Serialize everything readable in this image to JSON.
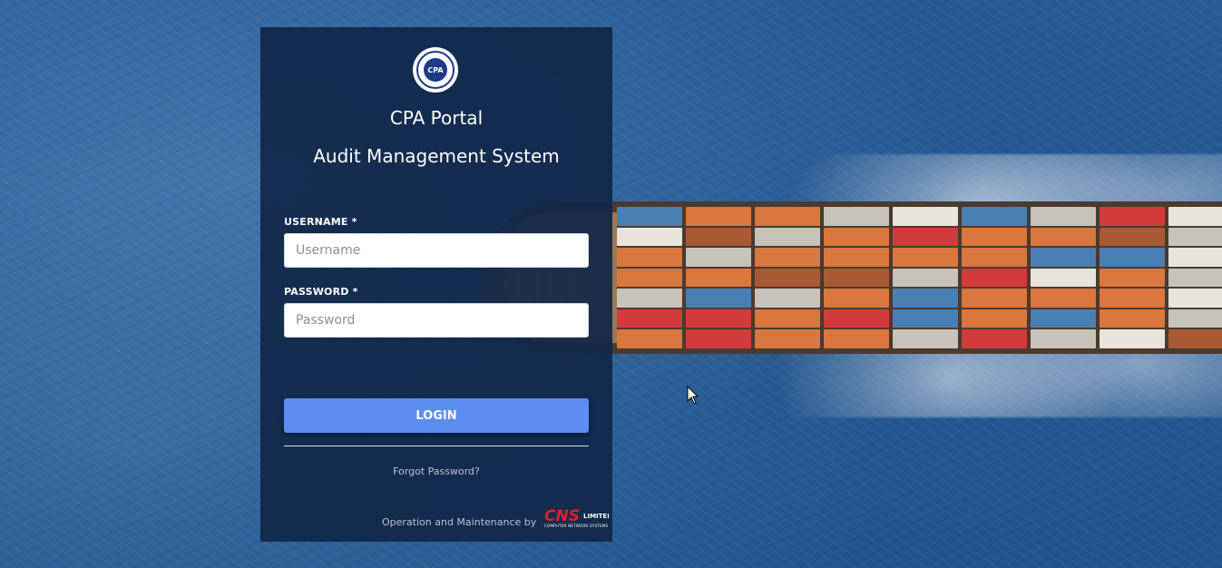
{
  "header": {
    "title": "CPA Portal",
    "subtitle": "Audit Management System"
  },
  "form": {
    "username": {
      "label": "USERNAME *",
      "placeholder": "Username",
      "value": ""
    },
    "password": {
      "label": "PASSWORD *",
      "placeholder": "Password",
      "value": ""
    },
    "login_label": "LOGIN",
    "forgot_label": "Forgot Password?"
  },
  "footer": {
    "text": "Operation and Maintenance by",
    "vendor_name": "CNS",
    "vendor_suffix": "LIMITED",
    "vendor_tagline": "COMPUTER NETWORK SYSTEMS"
  },
  "logo": {
    "emblem_text": "CPA"
  },
  "colors": {
    "panel_bg": "#102748",
    "button": "#5b8ef0",
    "vendor_red": "#e0202a"
  }
}
